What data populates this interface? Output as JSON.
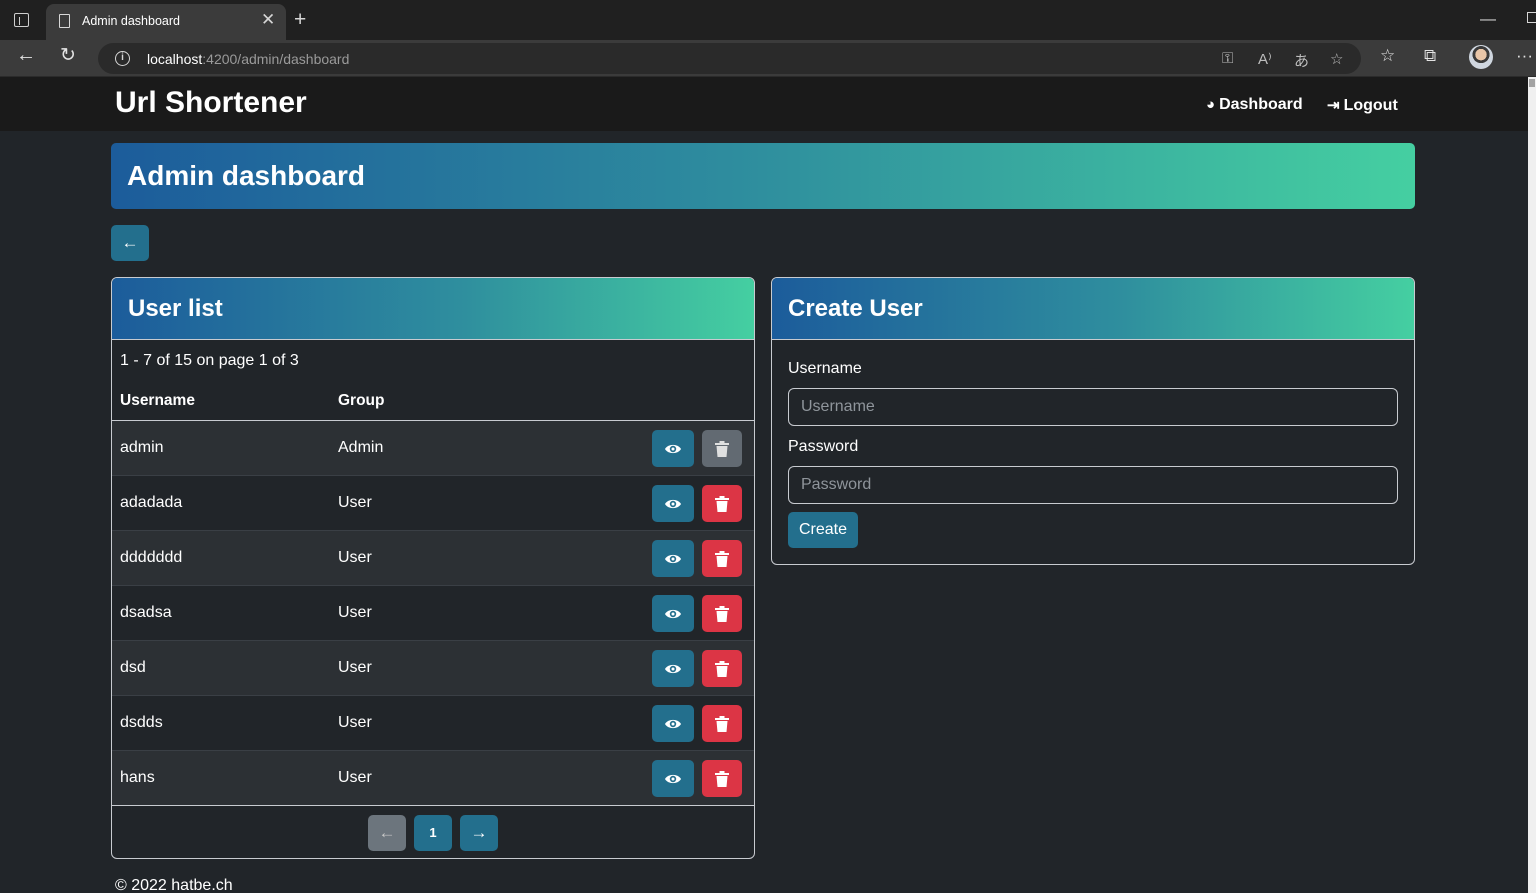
{
  "browser": {
    "tab_title": "Admin dashboard",
    "url_host": "localhost",
    "url_rest": ":4200/admin/dashboard"
  },
  "navbar": {
    "brand": "Url Shortener",
    "links": [
      {
        "label": "Dashboard",
        "icon": "palette-icon"
      },
      {
        "label": "Logout",
        "icon": "logout-icon"
      }
    ]
  },
  "page": {
    "title": "Admin dashboard",
    "back_icon": "arrow-left-icon"
  },
  "user_list": {
    "title": "User list",
    "page_info": "1 - 7 of 15 on page 1 of 3",
    "columns": [
      "Username",
      "Group"
    ],
    "rows": [
      {
        "username": "admin",
        "group": "Admin",
        "delete_disabled": true
      },
      {
        "username": "adadada",
        "group": "User",
        "delete_disabled": false
      },
      {
        "username": "ddddddd",
        "group": "User",
        "delete_disabled": false
      },
      {
        "username": "dsadsa",
        "group": "User",
        "delete_disabled": false
      },
      {
        "username": "dsd",
        "group": "User",
        "delete_disabled": false
      },
      {
        "username": "dsdds",
        "group": "User",
        "delete_disabled": false
      },
      {
        "username": "hans",
        "group": "User",
        "delete_disabled": false
      }
    ],
    "pagination": {
      "current_page": "1",
      "prev_icon": "arrow-left-icon",
      "next_icon": "arrow-right-icon"
    }
  },
  "create_user": {
    "title": "Create User",
    "username_label": "Username",
    "username_placeholder": "Username",
    "password_label": "Password",
    "password_placeholder": "Password",
    "submit_label": "Create"
  },
  "footer": {
    "text": "© 2022 hatbe.ch"
  },
  "colors": {
    "background": "#212529",
    "primary": "#236f8d",
    "danger": "#dc3545",
    "gradient_start": "#1c5c9b",
    "gradient_end": "#45cfa1"
  }
}
